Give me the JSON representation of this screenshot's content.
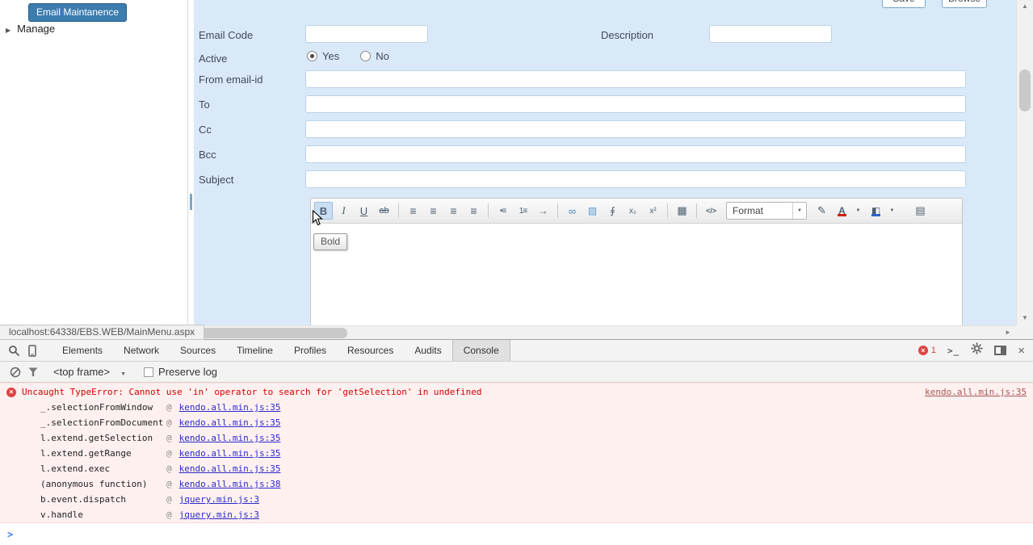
{
  "app": {
    "sidebar": {
      "badge": "Email Maintanence",
      "manage": "Manage"
    },
    "actions": {
      "save": "Save",
      "browse": "Browse"
    },
    "form": {
      "email_code_label": "Email Code",
      "description_label": "Description",
      "active_label": "Active",
      "yes_label": "Yes",
      "no_label": "No",
      "from_label": "From email-id",
      "to_label": "To",
      "cc_label": "Cc",
      "bcc_label": "Bcc",
      "subject_label": "Subject"
    },
    "editor": {
      "format_placeholder": "Format",
      "bold_tooltip": "Bold",
      "toolbar_icons": [
        "bold",
        "italic",
        "underline",
        "strikethrough",
        "justify-left",
        "justify-center",
        "justify-right",
        "justify-full",
        "insert-unordered-list",
        "insert-ordered-list",
        "indent",
        "create-link",
        "insert-image",
        "attachment",
        "subscript",
        "superscript",
        "create-table",
        "view-html",
        "format-dropdown",
        "pencil",
        "font-color",
        "background-color",
        "export-file"
      ]
    },
    "status_bubble": "localhost:64338/EBS.WEB/MainMenu.aspx"
  },
  "devtools": {
    "tabs": [
      "Elements",
      "Network",
      "Sources",
      "Timeline",
      "Profiles",
      "Resources",
      "Audits",
      "Console"
    ],
    "active_tab": "Console",
    "error_badge_count": "1",
    "frame_select": "<top frame>",
    "preserve_log_label": "Preserve log",
    "console": {
      "at": "@",
      "error": {
        "message": "Uncaught TypeError: Cannot use 'in' operator to search for 'getSelection' in undefined",
        "source": "kendo.all.min.js:35"
      },
      "stack": [
        {
          "fn": "_.selectionFromWindow",
          "src": "kendo.all.min.js:35"
        },
        {
          "fn": "_.selectionFromDocument",
          "src": "kendo.all.min.js:35"
        },
        {
          "fn": "l.extend.getSelection",
          "src": "kendo.all.min.js:35"
        },
        {
          "fn": "l.extend.getRange",
          "src": "kendo.all.min.js:35"
        },
        {
          "fn": "l.extend.exec",
          "src": "kendo.all.min.js:35"
        },
        {
          "fn": "(anonymous function)",
          "src": "kendo.all.min.js:38"
        },
        {
          "fn": "b.event.dispatch",
          "src": "jquery.min.js:3"
        },
        {
          "fn": "v.handle",
          "src": "jquery.min.js:3"
        }
      ]
    },
    "colors": {
      "error_text": "#d30000",
      "error_bg": "#fff0f0",
      "link_blue": "#2929c8",
      "badge_red": "#dd4444",
      "accent_blue": "#3c7caf"
    }
  }
}
